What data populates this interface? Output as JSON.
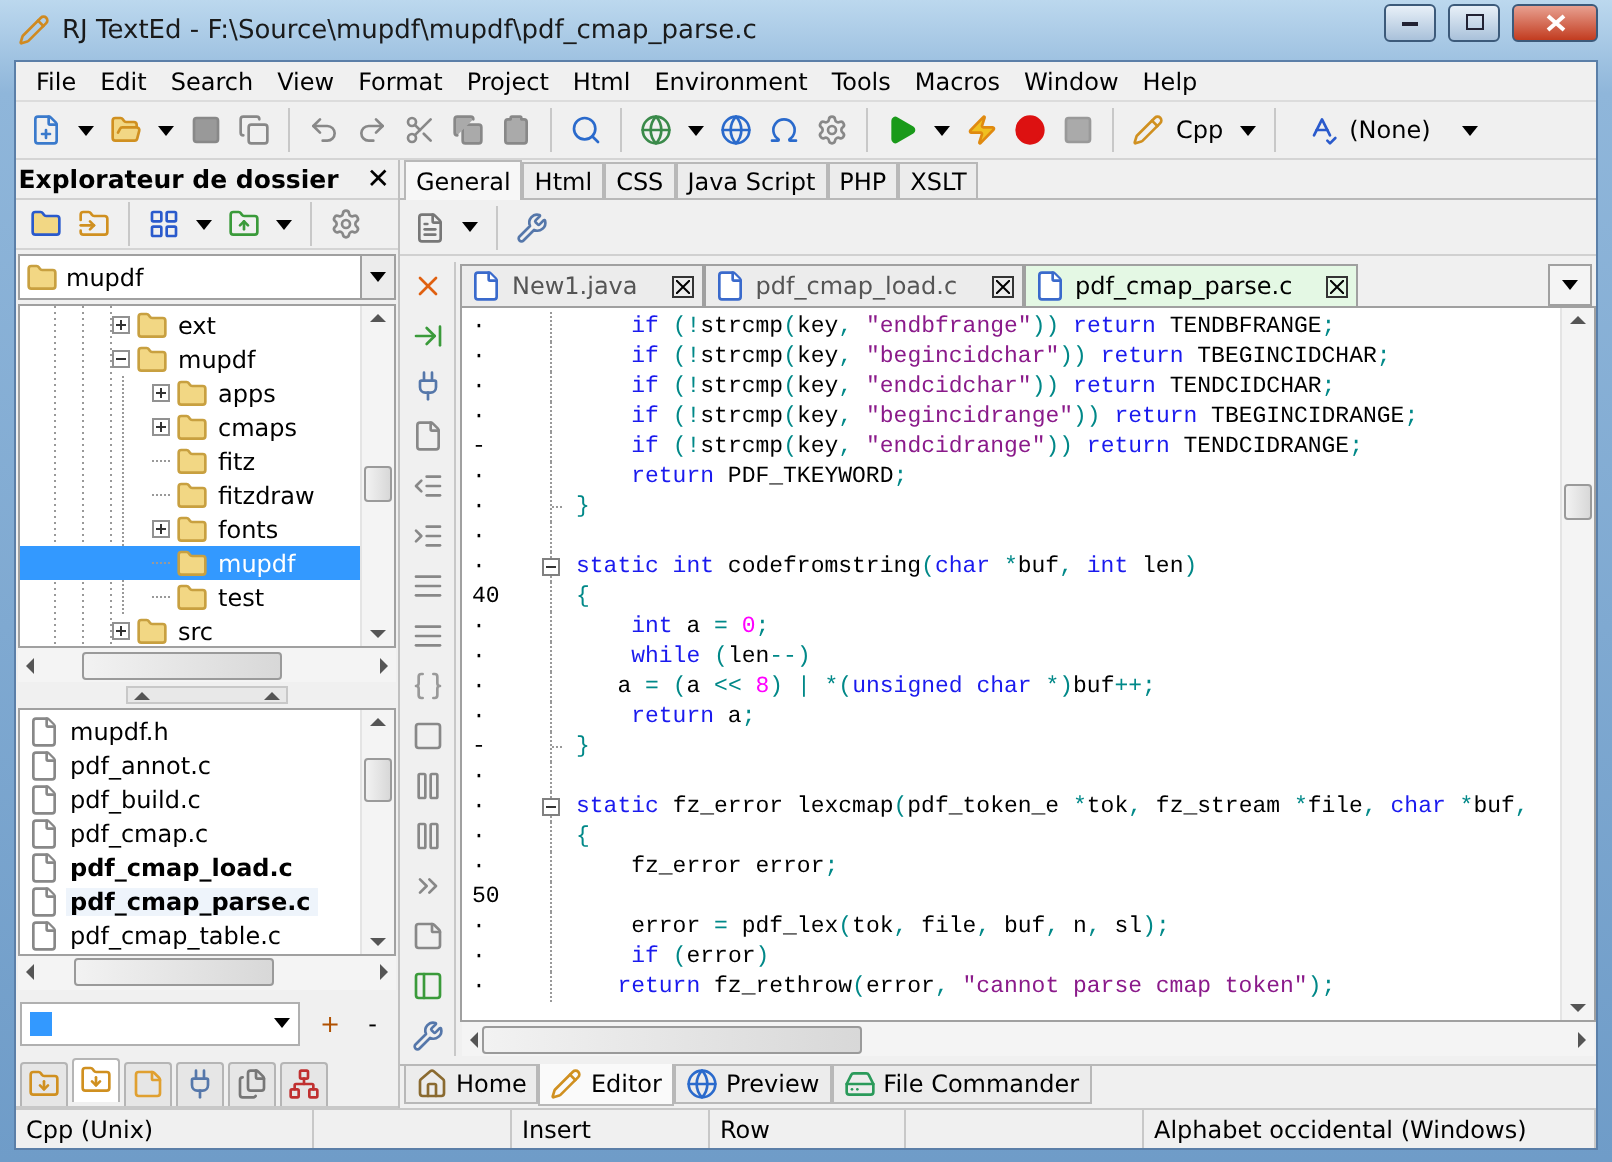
{
  "window": {
    "title": "RJ TextEd - F:\\Source\\mupdf\\mupdf\\pdf_cmap_parse.c"
  },
  "menu": [
    "File",
    "Edit",
    "Search",
    "View",
    "Format",
    "Project",
    "Html",
    "Environment",
    "Tools",
    "Macros",
    "Window",
    "Help"
  ],
  "toolbar": {
    "syntax": "Cpp",
    "dictionary": "(None)"
  },
  "explorer": {
    "title": "Explorateur de dossier",
    "close": "✕",
    "path": "mupdf",
    "tree": [
      {
        "label": "ext",
        "expandable": true,
        "expanded": false,
        "selected": false
      },
      {
        "label": "mupdf",
        "expandable": true,
        "expanded": true,
        "selected": false,
        "children": [
          {
            "label": "apps",
            "expandable": true,
            "expanded": false,
            "selected": false
          },
          {
            "label": "cmaps",
            "expandable": true,
            "expanded": false,
            "selected": false
          },
          {
            "label": "fitz",
            "expandable": false,
            "expanded": false,
            "selected": false
          },
          {
            "label": "fitzdraw",
            "expandable": false,
            "expanded": false,
            "selected": false
          },
          {
            "label": "fonts",
            "expandable": true,
            "expanded": false,
            "selected": false
          },
          {
            "label": "mupdf",
            "expandable": false,
            "expanded": false,
            "selected": true
          },
          {
            "label": "test",
            "expandable": false,
            "expanded": false,
            "selected": false
          }
        ]
      },
      {
        "label": "src",
        "expandable": true,
        "expanded": false,
        "selected": false
      }
    ],
    "files": [
      {
        "name": "mupdf.h",
        "open": false,
        "selected": false
      },
      {
        "name": "pdf_annot.c",
        "open": false,
        "selected": false
      },
      {
        "name": "pdf_build.c",
        "open": false,
        "selected": false
      },
      {
        "name": "pdf_cmap.c",
        "open": false,
        "selected": false
      },
      {
        "name": "pdf_cmap_load.c",
        "open": true,
        "selected": false
      },
      {
        "name": "pdf_cmap_parse.c",
        "open": true,
        "selected": true
      },
      {
        "name": "pdf_cmap_table.c",
        "open": false,
        "selected": false
      }
    ],
    "filter_add": "+",
    "filter_remove": "-",
    "panel_tabs": [
      {
        "selected": false
      },
      {
        "selected": true
      },
      {
        "selected": false
      },
      {
        "selected": false
      },
      {
        "selected": false
      },
      {
        "selected": false
      }
    ]
  },
  "tool_tabs": [
    {
      "label": "General",
      "selected": true
    },
    {
      "label": "Html",
      "selected": false
    },
    {
      "label": "CSS",
      "selected": false
    },
    {
      "label": "Java Script",
      "selected": false
    },
    {
      "label": "PHP",
      "selected": false
    },
    {
      "label": "XSLT",
      "selected": false
    }
  ],
  "documents": [
    {
      "label": "New1.java",
      "selected": false
    },
    {
      "label": "pdf_cmap_load.c",
      "selected": false
    },
    {
      "label": "pdf_cmap_parse.c",
      "selected": true
    }
  ],
  "editor": {
    "lines": [
      {
        "gutter": "·",
        "tokens": [
          {
            "kind": "kw",
            "text": "    if"
          },
          {
            "kind": "punc",
            "text": " (!"
          },
          {
            "kind": "id",
            "text": "strcmp"
          },
          {
            "kind": "punc",
            "text": "("
          },
          {
            "kind": "id",
            "text": "key"
          },
          {
            "kind": "punc",
            "text": ", "
          },
          {
            "kind": "str",
            "text": "\"endbfrange\""
          },
          {
            "kind": "punc",
            "text": "))"
          },
          {
            "kind": "kw",
            "text": " return"
          },
          {
            "kind": "id",
            "text": " TENDBFRANGE"
          },
          {
            "kind": "punc",
            "text": ";"
          }
        ]
      },
      {
        "gutter": "·",
        "tokens": [
          {
            "kind": "kw",
            "text": "    if"
          },
          {
            "kind": "punc",
            "text": " (!"
          },
          {
            "kind": "id",
            "text": "strcmp"
          },
          {
            "kind": "punc",
            "text": "("
          },
          {
            "kind": "id",
            "text": "key"
          },
          {
            "kind": "punc",
            "text": ", "
          },
          {
            "kind": "str",
            "text": "\"begincidchar\""
          },
          {
            "kind": "punc",
            "text": "))"
          },
          {
            "kind": "kw",
            "text": " return"
          },
          {
            "kind": "id",
            "text": " TBEGINCIDCHAR"
          },
          {
            "kind": "punc",
            "text": ";"
          }
        ]
      },
      {
        "gutter": "·",
        "tokens": [
          {
            "kind": "kw",
            "text": "    if"
          },
          {
            "kind": "punc",
            "text": " (!"
          },
          {
            "kind": "id",
            "text": "strcmp"
          },
          {
            "kind": "punc",
            "text": "("
          },
          {
            "kind": "id",
            "text": "key"
          },
          {
            "kind": "punc",
            "text": ", "
          },
          {
            "kind": "str",
            "text": "\"endcidchar\""
          },
          {
            "kind": "punc",
            "text": "))"
          },
          {
            "kind": "kw",
            "text": " return"
          },
          {
            "kind": "id",
            "text": " TENDCIDCHAR"
          },
          {
            "kind": "punc",
            "text": ";"
          }
        ]
      },
      {
        "gutter": "·",
        "tokens": [
          {
            "kind": "kw",
            "text": "    if"
          },
          {
            "kind": "punc",
            "text": " (!"
          },
          {
            "kind": "id",
            "text": "strcmp"
          },
          {
            "kind": "punc",
            "text": "("
          },
          {
            "kind": "id",
            "text": "key"
          },
          {
            "kind": "punc",
            "text": ", "
          },
          {
            "kind": "str",
            "text": "\"begincidrange\""
          },
          {
            "kind": "punc",
            "text": "))"
          },
          {
            "kind": "kw",
            "text": " return"
          },
          {
            "kind": "id",
            "text": " TBEGINCIDRANGE"
          },
          {
            "kind": "punc",
            "text": ";"
          }
        ]
      },
      {
        "gutter": "-",
        "tokens": [
          {
            "kind": "kw",
            "text": "    if"
          },
          {
            "kind": "punc",
            "text": " (!"
          },
          {
            "kind": "id",
            "text": "strcmp"
          },
          {
            "kind": "punc",
            "text": "("
          },
          {
            "kind": "id",
            "text": "key"
          },
          {
            "kind": "punc",
            "text": ", "
          },
          {
            "kind": "str",
            "text": "\"endcidrange\""
          },
          {
            "kind": "punc",
            "text": "))"
          },
          {
            "kind": "kw",
            "text": " return"
          },
          {
            "kind": "id",
            "text": " TENDCIDRANGE"
          },
          {
            "kind": "punc",
            "text": ";"
          }
        ]
      },
      {
        "gutter": "·",
        "tokens": [
          {
            "kind": "kw",
            "text": "    return"
          },
          {
            "kind": "id",
            "text": " PDF_TKEYWORD"
          },
          {
            "kind": "punc",
            "text": ";"
          }
        ]
      },
      {
        "gutter": "·",
        "fold_end": true,
        "tokens": [
          {
            "kind": "punc",
            "text": "}"
          }
        ]
      },
      {
        "gutter": "·"
      },
      {
        "gutter": "·",
        "fold_start": true,
        "tokens": [
          {
            "kind": "kw",
            "text": "static int"
          },
          {
            "kind": "id",
            "text": " codefromstring"
          },
          {
            "kind": "punc",
            "text": "("
          },
          {
            "kind": "kw",
            "text": "char"
          },
          {
            "kind": "punc",
            "text": " *"
          },
          {
            "kind": "id",
            "text": "buf"
          },
          {
            "kind": "punc",
            "text": ", "
          },
          {
            "kind": "kw",
            "text": "int"
          },
          {
            "kind": "id",
            "text": " len"
          },
          {
            "kind": "punc",
            "text": ")"
          }
        ]
      },
      {
        "gutter": "40",
        "tokens": [
          {
            "kind": "punc",
            "text": "{"
          }
        ]
      },
      {
        "gutter": "·",
        "tokens": [
          {
            "kind": "kw",
            "text": "    int"
          },
          {
            "kind": "id",
            "text": " a "
          },
          {
            "kind": "punc",
            "text": "= "
          },
          {
            "kind": "num",
            "text": "0"
          },
          {
            "kind": "punc",
            "text": ";"
          }
        ]
      },
      {
        "gutter": "·",
        "tokens": [
          {
            "kind": "kw",
            "text": "    while"
          },
          {
            "kind": "punc",
            "text": " ("
          },
          {
            "kind": "id",
            "text": "len"
          },
          {
            "kind": "punc",
            "text": "--)"
          }
        ]
      },
      {
        "gutter": "·",
        "tokens": [
          {
            "kind": "id",
            "text": "   a "
          },
          {
            "kind": "punc",
            "text": "= ("
          },
          {
            "kind": "id",
            "text": "a "
          },
          {
            "kind": "punc",
            "text": "<< "
          },
          {
            "kind": "num",
            "text": "8"
          },
          {
            "kind": "punc",
            "text": ") | *("
          },
          {
            "kind": "kw",
            "text": "unsigned char"
          },
          {
            "kind": "punc",
            "text": " *)"
          },
          {
            "kind": "id",
            "text": "buf"
          },
          {
            "kind": "punc",
            "text": "++;"
          }
        ]
      },
      {
        "gutter": "·",
        "tokens": [
          {
            "kind": "kw",
            "text": "    return"
          },
          {
            "kind": "id",
            "text": " a"
          },
          {
            "kind": "punc",
            "text": ";"
          }
        ]
      },
      {
        "gutter": "-",
        "fold_end": true,
        "tokens": [
          {
            "kind": "punc",
            "text": "}"
          }
        ]
      },
      {
        "gutter": "·"
      },
      {
        "gutter": "·",
        "fold_start": true,
        "tokens": [
          {
            "kind": "kw",
            "text": "static"
          },
          {
            "kind": "id",
            "text": " fz_error lexcmap"
          },
          {
            "kind": "punc",
            "text": "("
          },
          {
            "kind": "id",
            "text": "pdf_token_e "
          },
          {
            "kind": "punc",
            "text": "*"
          },
          {
            "kind": "id",
            "text": "tok"
          },
          {
            "kind": "punc",
            "text": ", "
          },
          {
            "kind": "id",
            "text": "fz_stream "
          },
          {
            "kind": "punc",
            "text": "*"
          },
          {
            "kind": "id",
            "text": "file"
          },
          {
            "kind": "punc",
            "text": ", "
          },
          {
            "kind": "kw",
            "text": "char"
          },
          {
            "kind": "punc",
            "text": " *"
          },
          {
            "kind": "id",
            "text": "buf"
          },
          {
            "kind": "punc",
            "text": ","
          }
        ]
      },
      {
        "gutter": "·",
        "tokens": [
          {
            "kind": "punc",
            "text": "{"
          }
        ]
      },
      {
        "gutter": "·",
        "tokens": [
          {
            "kind": "id",
            "text": "    fz_error error"
          },
          {
            "kind": "punc",
            "text": ";"
          }
        ]
      },
      {
        "gutter": "50"
      },
      {
        "gutter": "·",
        "tokens": [
          {
            "kind": "id",
            "text": "    error "
          },
          {
            "kind": "punc",
            "text": "= "
          },
          {
            "kind": "id",
            "text": "pdf_lex"
          },
          {
            "kind": "punc",
            "text": "("
          },
          {
            "kind": "id",
            "text": "tok"
          },
          {
            "kind": "punc",
            "text": ", "
          },
          {
            "kind": "id",
            "text": "file"
          },
          {
            "kind": "punc",
            "text": ", "
          },
          {
            "kind": "id",
            "text": "buf"
          },
          {
            "kind": "punc",
            "text": ", "
          },
          {
            "kind": "id",
            "text": "n"
          },
          {
            "kind": "punc",
            "text": ", "
          },
          {
            "kind": "id",
            "text": "sl"
          },
          {
            "kind": "punc",
            "text": ");"
          }
        ]
      },
      {
        "gutter": "·",
        "tokens": [
          {
            "kind": "kw",
            "text": "    if"
          },
          {
            "kind": "punc",
            "text": " ("
          },
          {
            "kind": "id",
            "text": "error"
          },
          {
            "kind": "punc",
            "text": ")"
          }
        ]
      },
      {
        "gutter": "·",
        "tokens": [
          {
            "kind": "kw",
            "text": "   return"
          },
          {
            "kind": "id",
            "text": " fz_rethrow"
          },
          {
            "kind": "punc",
            "text": "("
          },
          {
            "kind": "id",
            "text": "error"
          },
          {
            "kind": "punc",
            "text": ", "
          },
          {
            "kind": "str",
            "text": "\"cannot parse cmap token\""
          },
          {
            "kind": "punc",
            "text": ");"
          }
        ]
      }
    ]
  },
  "view_tabs": [
    {
      "label": "Home",
      "selected": false
    },
    {
      "label": "Editor",
      "selected": true
    },
    {
      "label": "Preview",
      "selected": false
    },
    {
      "label": "File Commander",
      "selected": false
    }
  ],
  "status_bar": {
    "syntax": "Cpp (Unix)",
    "mode": "Insert",
    "position": "Row",
    "encoding": "Alphabet occidental (Windows)"
  }
}
